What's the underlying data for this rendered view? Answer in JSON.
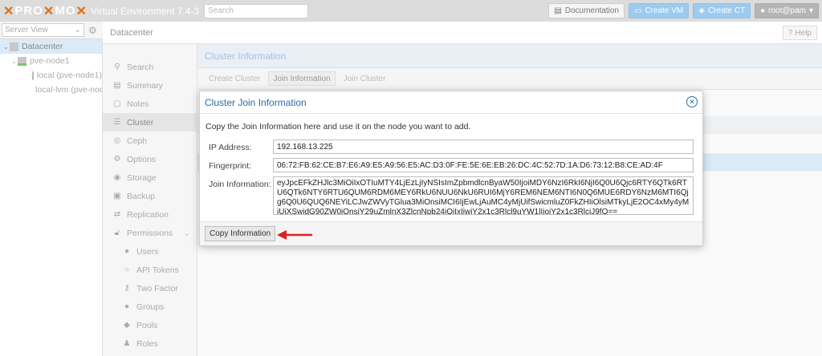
{
  "topbar": {
    "logo_left": "PRO",
    "logo_mid": "MO",
    "ve_text": "Virtual Environment 7.4-3",
    "search_placeholder": "Search",
    "documentation_label": "Documentation",
    "create_vm_label": "Create VM",
    "create_ct_label": "Create CT",
    "user_label": "root@pam"
  },
  "tree": {
    "view_label": "Server View",
    "nodes": [
      {
        "label": "Datacenter"
      },
      {
        "label": "pve-node1"
      },
      {
        "label": "local (pve-node1)"
      },
      {
        "label": "local-lvm (pve-node1)"
      }
    ]
  },
  "header": {
    "breadcrumb": "Datacenter",
    "help_label": "Help"
  },
  "menu": {
    "items": [
      {
        "label": "Search"
      },
      {
        "label": "Summary"
      },
      {
        "label": "Notes"
      },
      {
        "label": "Cluster"
      },
      {
        "label": "Ceph"
      },
      {
        "label": "Options"
      },
      {
        "label": "Storage"
      },
      {
        "label": "Backup"
      },
      {
        "label": "Replication"
      },
      {
        "label": "Permissions"
      },
      {
        "label": "Users"
      },
      {
        "label": "API Tokens"
      },
      {
        "label": "Two Factor"
      },
      {
        "label": "Groups"
      },
      {
        "label": "Pools"
      },
      {
        "label": "Roles"
      }
    ]
  },
  "main": {
    "panel_title": "Cluster Information",
    "toolbar": {
      "create_cluster": "Create Cluster",
      "join_information": "Join Information",
      "join_cluster": "Join Cluster"
    }
  },
  "dialog": {
    "title": "Cluster Join Information",
    "message": "Copy the Join Information here and use it on the node you want to add.",
    "ip_label": "IP Address:",
    "ip_value": "192.168.13.225",
    "fingerprint_label": "Fingerprint:",
    "fingerprint_value": "06:72:FB:62:CE:B7:E6:A9:E5:A9:56:E5:AC:D3:0F:FE:5E:6E:EB:26:DC:4C:52:7D:1A:D6:73:12:B8:CE:AD:4F",
    "join_label": "Join Information:",
    "join_value": "eyJpcEFkZHJlc3MiOiIxOTIuMTY4LjEzLjIyNSIsImZpbmdlcnByaW50IjoiMDY6NzI6RkI6NjI6Q0U6Qjc6RTY6QTk6RTU6QTk6NTY6RTU6QUM6RDM6MEY6RkU6NUU6NkU6RUI6MjY6REM6NEM6NTI6N0Q6MUE6RDY6NzM6MTI6Qjg6Q0U6QUQ6NEYiLCJwZWVyTGlua3MiOnsiMCI6IjEwLjAuMC4yMjUifSwicmluZ0FkZHIiOlsiMTkyLjE2OC4xMy4yMjUiXSwidG90ZW0iOnsiY29uZmlnX3ZlcnNpb24iOiIxIiwiY2x1c3Rlcl9uYW1lIjoiY2x1c3RlciJ9fQ==",
    "copy_button": "Copy Information"
  },
  "colors": {
    "accent": "#2a6ba8",
    "arrow": "#e02020",
    "logo_x": "#e57000"
  }
}
